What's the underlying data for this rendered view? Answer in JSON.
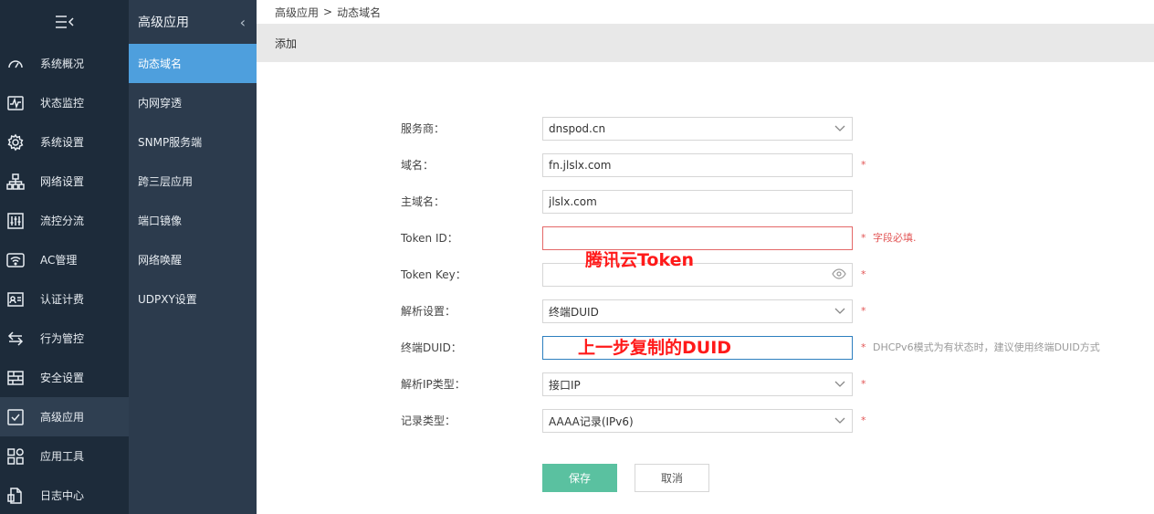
{
  "sidebar_primary": {
    "toggle_icon": "menu-collapse-icon",
    "items": [
      {
        "label": "系统概况",
        "icon": "dashboard-icon"
      },
      {
        "label": "状态监控",
        "icon": "monitor-icon"
      },
      {
        "label": "系统设置",
        "icon": "gear-icon"
      },
      {
        "label": "网络设置",
        "icon": "network-icon"
      },
      {
        "label": "流控分流",
        "icon": "sliders-icon"
      },
      {
        "label": "AC管理",
        "icon": "wifi-icon"
      },
      {
        "label": "认证计费",
        "icon": "id-card-icon"
      },
      {
        "label": "行为管控",
        "icon": "arrows-icon"
      },
      {
        "label": "安全设置",
        "icon": "firewall-icon"
      },
      {
        "label": "高级应用",
        "icon": "checklist-icon",
        "active": true
      },
      {
        "label": "应用工具",
        "icon": "apps-icon"
      },
      {
        "label": "日志中心",
        "icon": "log-icon"
      }
    ]
  },
  "sidebar_secondary": {
    "title": "高级应用",
    "items": [
      {
        "label": "动态域名",
        "active": true
      },
      {
        "label": "内网穿透"
      },
      {
        "label": "SNMP服务端"
      },
      {
        "label": "跨三层应用"
      },
      {
        "label": "端口镜像"
      },
      {
        "label": "网络唤醒"
      },
      {
        "label": "UDPXY设置"
      }
    ]
  },
  "breadcrumb": {
    "parent": "高级应用",
    "separator": ">",
    "current": "动态域名"
  },
  "panel": {
    "title": "添加"
  },
  "form": {
    "provider": {
      "label": "服务商：",
      "value": "dnspod.cn"
    },
    "domain": {
      "label": "域名：",
      "value": "fn.jlslx.com",
      "required": "*"
    },
    "main_domain": {
      "label": "主域名：",
      "value": "jlslx.com"
    },
    "token_id": {
      "label": "Token ID：",
      "value": "",
      "required": "*",
      "error": "字段必填."
    },
    "token_key": {
      "label": "Token Key：",
      "value": "",
      "required": "*"
    },
    "resolve": {
      "label": "解析设置：",
      "value": "终端DUID",
      "required": "*"
    },
    "duid": {
      "label": "终端DUID：",
      "value": "",
      "required": "*",
      "hint": "DHCPv6模式为有状态时，建议使用终端DUID方式"
    },
    "ip_type": {
      "label": "解析IP类型：",
      "value": "接口IP",
      "required": "*"
    },
    "record_type": {
      "label": "记录类型：",
      "value": "AAAA记录(IPv6)",
      "required": "*"
    }
  },
  "annotations": {
    "token": "腾讯云Token",
    "duid": "上一步复制的DUID"
  },
  "buttons": {
    "save": "保存",
    "cancel": "取消"
  },
  "colors": {
    "sidebar_primary_bg": "#1d2b3a",
    "sidebar_secondary_bg": "#2c3b4d",
    "active_item": "#4e9fdd",
    "save_button": "#5ac1a0",
    "required_red": "#e25555",
    "annotation_red": "#ff1a1a"
  }
}
